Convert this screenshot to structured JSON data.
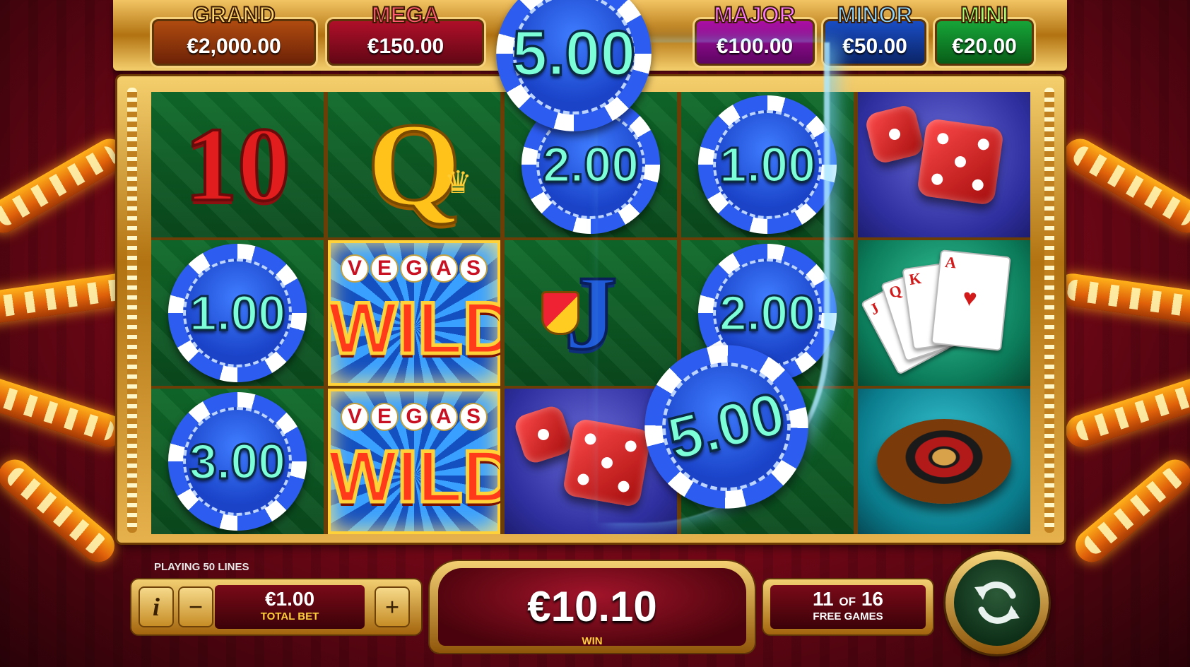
{
  "jackpots": {
    "grand": {
      "label": "GRAND",
      "value": "€2,000.00"
    },
    "mega": {
      "label": "MEGA",
      "value": "€150.00"
    },
    "major": {
      "label": "MAJOR",
      "value": "€100.00"
    },
    "minor": {
      "label": "MINOR",
      "value": "€50.00"
    },
    "mini": {
      "label": "MINI",
      "value": "€20.00"
    }
  },
  "flying_chips": {
    "top": "5.00",
    "landing": "5.00"
  },
  "reels": [
    {
      "symbols": [
        "10",
        "chip",
        "chip"
      ],
      "chip_values": [
        "1.00",
        "3.00"
      ]
    },
    {
      "symbols": [
        "Q",
        "wild",
        "wild"
      ]
    },
    {
      "symbols": [
        "chip",
        "J",
        "dice"
      ],
      "chip_values": [
        "2.00"
      ]
    },
    {
      "symbols": [
        "chip",
        "chip",
        "chip"
      ],
      "chip_values": [
        "1.00",
        "2.00",
        "5.00"
      ]
    },
    {
      "symbols": [
        "dice",
        "cards",
        "roulette"
      ]
    }
  ],
  "wild": {
    "top_word": "VEGAS",
    "word": "WILD"
  },
  "controls": {
    "lines_text": "PLAYING 50 LINES",
    "info_label": "i",
    "minus_label": "−",
    "plus_label": "+",
    "total_bet_value": "€1.00",
    "total_bet_label": "TOTAL BET",
    "win_value": "€10.10",
    "win_label": "WIN",
    "free_games_current": "11",
    "free_games_of": "OF",
    "free_games_total": "16",
    "free_games_label": "FREE GAMES"
  },
  "icons": {
    "spin": "refresh-arrows-icon",
    "crown": "crown-icon",
    "shield": "shield-icon"
  },
  "colors": {
    "background_red": "#8a0a1c",
    "frame_gold": "#d9a23a",
    "reel_green": "#0f6a2a",
    "chip_blue": "#2d5cf0",
    "chip_text": "#7cffd8"
  }
}
